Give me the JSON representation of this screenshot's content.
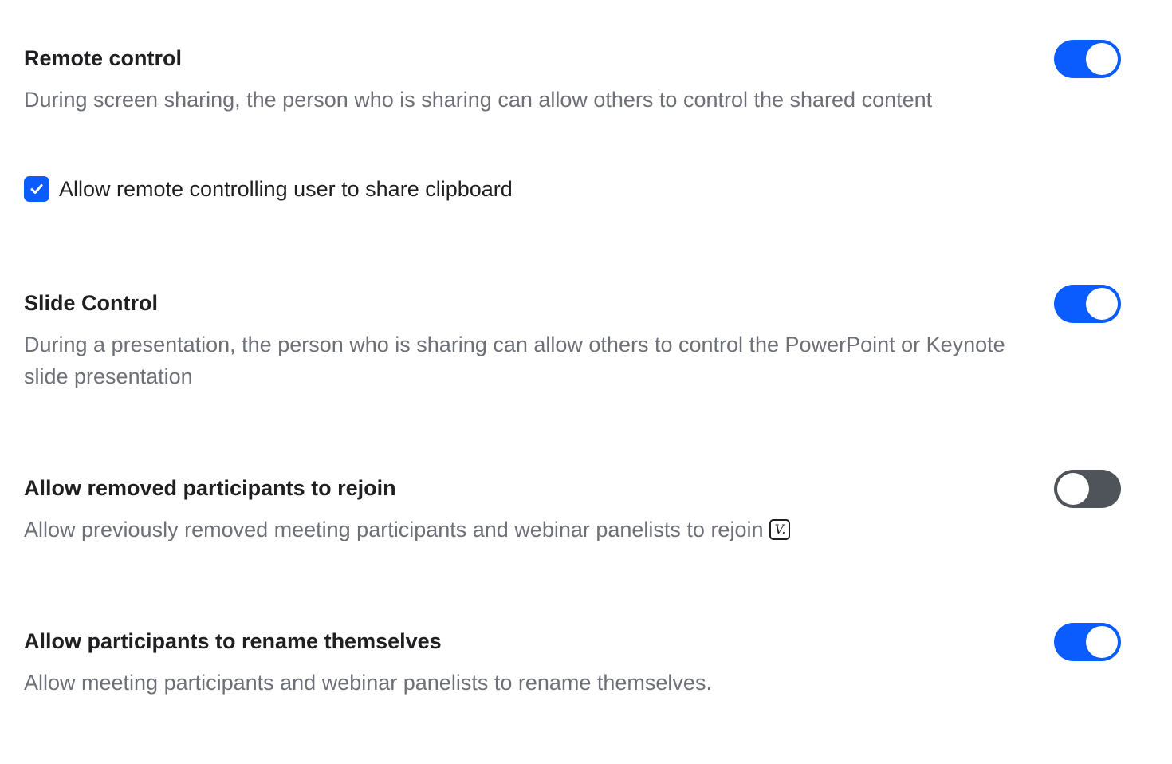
{
  "settings": [
    {
      "title": "Remote control",
      "description": "During screen sharing, the person who is sharing can allow others to control the shared content",
      "enabled": true,
      "option": {
        "label": "Allow remote controlling user to share clipboard",
        "checked": true
      }
    },
    {
      "title": "Slide Control",
      "description": "During a presentation, the person who is sharing can allow others to control the PowerPoint or Keynote slide presentation",
      "enabled": true
    },
    {
      "title": "Allow removed participants to rejoin",
      "description": "Allow previously removed meeting participants and webinar panelists to rejoin",
      "badge": "V.",
      "enabled": false
    },
    {
      "title": "Allow participants to rename themselves",
      "description": "Allow meeting participants and webinar panelists to rename themselves.",
      "enabled": true
    }
  ],
  "colors": {
    "accent": "#0b5cff",
    "toggle_off": "#4f545b",
    "title_text": "#1f1f22",
    "description_text": "#6e7078"
  }
}
